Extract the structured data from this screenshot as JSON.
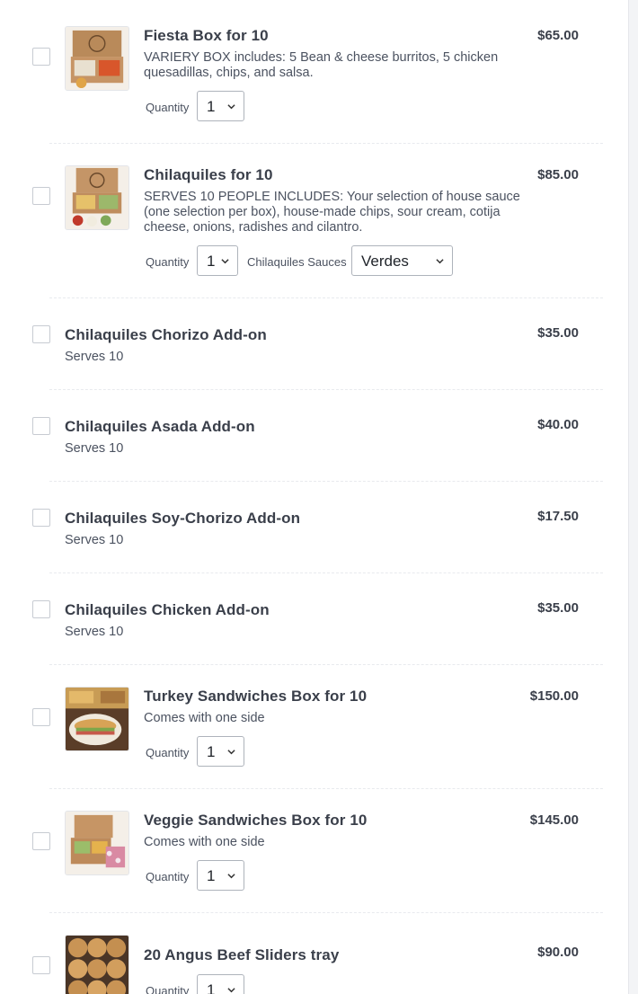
{
  "items": [
    {
      "name": "Fiesta Box for 10",
      "description": "VARIERY BOX includes: 5 Bean & cheese burritos, 5 chicken quesadillas, chips, and salsa.",
      "price": "$65.00",
      "quantity_label": "Quantity",
      "quantity_value": "1",
      "image_icon": "fiesta-box-photo"
    },
    {
      "name": "Chilaquiles for 10",
      "description": "SERVES 10 PEOPLE INCLUDES: Your selection of house sauce (one selection per box), house-made chips, sour cream, cotija cheese, onions, radishes and cilantro.",
      "price": "$85.00",
      "quantity_label": "Quantity",
      "quantity_value": "1",
      "sauce_label": "Chilaquiles Sauces",
      "sauce_value": "Verdes",
      "image_icon": "chilaquiles-box-photo"
    },
    {
      "name": "Chilaquiles Chorizo Add-on",
      "description": "Serves 10",
      "price": "$35.00"
    },
    {
      "name": "Chilaquiles Asada Add-on",
      "description": "Serves 10",
      "price": "$40.00"
    },
    {
      "name": "Chilaquiles Soy-Chorizo Add-on",
      "description": "Serves 10",
      "price": "$17.50"
    },
    {
      "name": "Chilaquiles Chicken Add-on",
      "description": "Serves 10",
      "price": "$35.00"
    },
    {
      "name": "Turkey Sandwiches Box for 10",
      "description": "Comes with one side",
      "price": "$150.00",
      "quantity_label": "Quantity",
      "quantity_value": "1",
      "image_icon": "turkey-sandwich-photo"
    },
    {
      "name": "Veggie Sandwiches Box for 10",
      "description": "Comes with one side",
      "price": "$145.00",
      "quantity_label": "Quantity",
      "quantity_value": "1",
      "image_icon": "veggie-sandwich-box-photo"
    },
    {
      "name": "20 Angus Beef Sliders tray",
      "price": "$90.00",
      "quantity_label": "Quantity",
      "quantity_value": "1",
      "image_icon": "sliders-tray-photo"
    }
  ],
  "colors": {
    "text": "#3a3f4a",
    "border": "#aeb3bb",
    "divider": "#e8eaee"
  }
}
